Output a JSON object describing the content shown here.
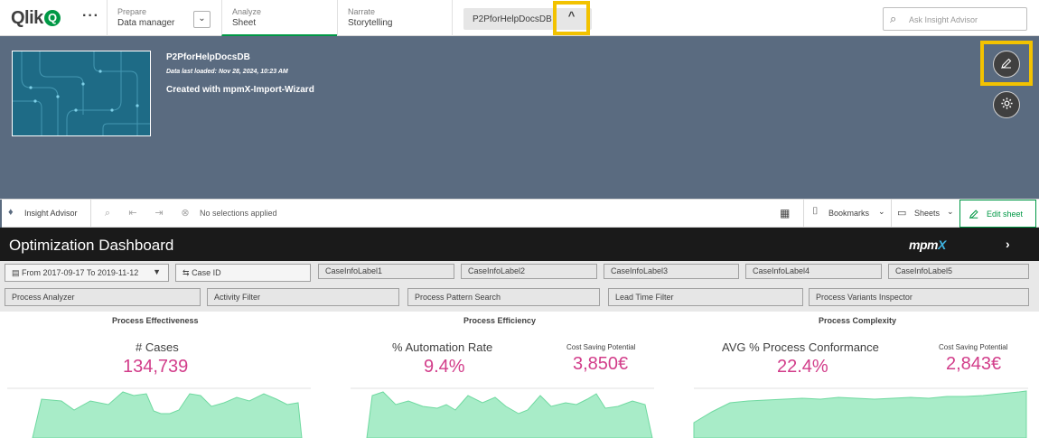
{
  "topbar": {
    "logo_text": "Qlik",
    "logo_mark": "Q",
    "more_icon": "more-dots-icon",
    "prepare": {
      "sup": "Prepare",
      "main": "Data manager"
    },
    "dropdown_glyph": "⌄",
    "analyze": {
      "sup": "Analyze",
      "main": "Sheet"
    },
    "narrate": {
      "sup": "Narrate",
      "main": "Storytelling"
    },
    "app_name": "P2PforHelpDocsDB",
    "caret_glyph": "^",
    "ask_placeholder": "Ask Insight Advisor",
    "brand_color": "#009845",
    "highlight_color": "#f2c200"
  },
  "overview": {
    "title": "P2PforHelpDocsDB",
    "data_loaded": "Data last loaded: Nov 28, 2024, 10:23 AM",
    "description": "Created with mpmX-Import-Wizard",
    "edit_icon": "pencil-icon",
    "settings_icon": "gear-icon",
    "background_color": "#5a6b80"
  },
  "selbar": {
    "insight_label": "Insight Advisor",
    "no_selections": "No selections applied",
    "bookmarks": "Bookmarks",
    "sheets": "Sheets",
    "edit_sheet": "Edit sheet"
  },
  "dashboard": {
    "title": "Optimization Dashboard",
    "logo_mpm": "mpm",
    "logo_x": "X",
    "next_glyph": "›"
  },
  "filters": {
    "row1": [
      "From 2017-09-17 To 2019-11-12",
      "Case ID",
      "CaseInfoLabel1",
      "CaseInfoLabel2",
      "CaseInfoLabel3",
      "CaseInfoLabel4",
      "CaseInfoLabel5"
    ],
    "row2": [
      "Process Analyzer",
      "Activity Filter",
      "Process Pattern Search",
      "Lead Time Filter",
      "Process Variants Inspector"
    ]
  },
  "kpis": {
    "effectiveness": {
      "title": "Process Effectiveness",
      "label": "# Cases",
      "value": "134,739"
    },
    "efficiency": {
      "title": "Process Efficiency",
      "label": "% Automation Rate",
      "value": "9.4%",
      "small_label": "Cost Saving Potential",
      "small_value": "3,850€"
    },
    "complexity": {
      "title": "Process Complexity",
      "label": "AVG % Process Conformance",
      "value": "22.4%",
      "small_label": "Cost Saving Potential",
      "small_value": "2,843€"
    },
    "value_color": "#d23d8a",
    "spark_color": "#a8ecc8"
  }
}
